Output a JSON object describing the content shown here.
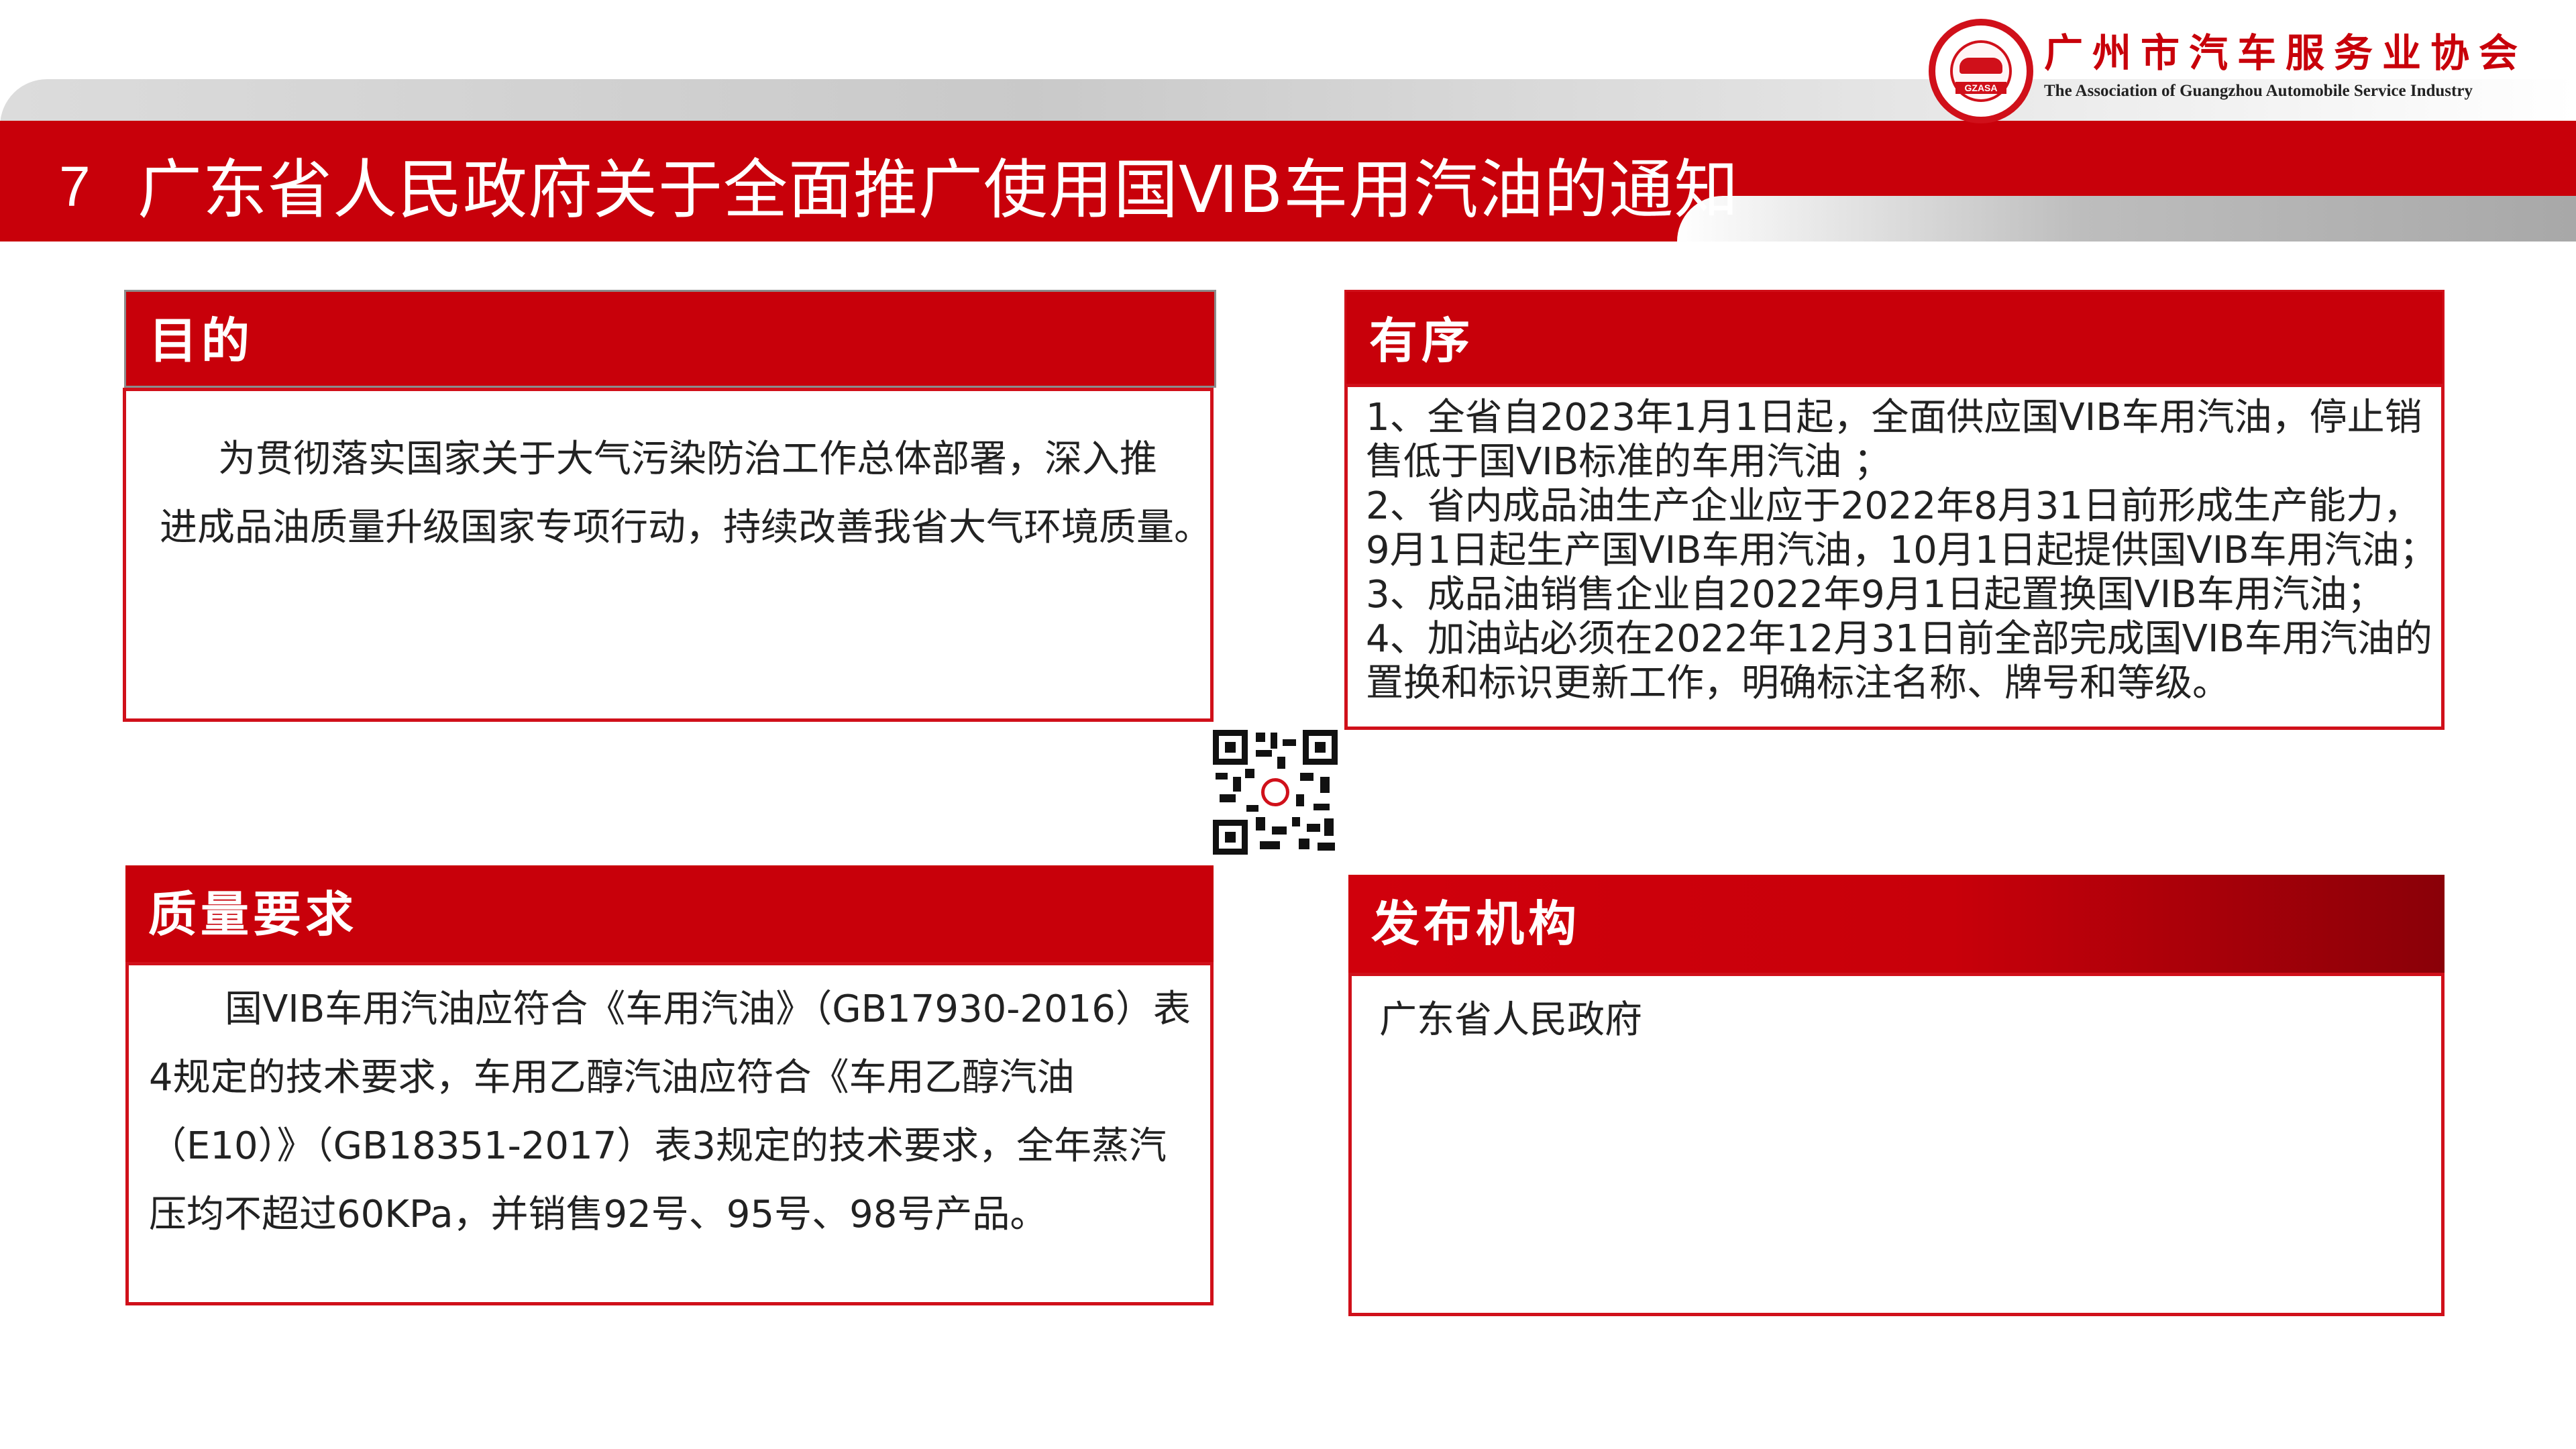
{
  "header": {
    "number": "7",
    "title": "广东省人民政府关于全面推广使用国ⅥB车用汽油的通知",
    "org_cn": "广州市汽车服务业协会",
    "org_en": "The Association of Guangzhou Automobile Service Industry",
    "seal_text": "GZASA"
  },
  "colors": {
    "brand_red": "#c8000a",
    "border_red": "#d0101a"
  },
  "icons": {
    "logo": "association-seal-icon",
    "qr": "qr-code-icon"
  },
  "panels": {
    "purpose": {
      "title": "目的",
      "lines": [
        "为贯彻落实国家关于大气污染防治工作总体部署，深入推",
        "进成品油质量升级国家专项行动，持续改善我省大气环境质量。"
      ]
    },
    "order": {
      "title": "有序",
      "lines": [
        "1、全省自2023年1月1日起，全面供应国VIB车用汽油，停止销",
        "售低于国VIB标准的车用汽油 ；",
        "2、省内成品油生产企业应于2022年8月31日前形成生产能力，",
        "9月1日起生产国VIB车用汽油，10月1日起提供国VIB车用汽油；",
        "3、成品油销售企业自2022年9月1日起置换国VIB车用汽油；",
        "4、加油站必须在2022年12月31日前全部完成国VIB车用汽油的",
        "置换和标识更新工作，明确标注名称、牌号和等级。"
      ]
    },
    "quality": {
      "title": "质量要求",
      "lines": [
        "国VIB车用汽油应符合《车用汽油》（GB17930-2016）表",
        "4规定的技术要求，车用乙醇汽油应符合《车用乙醇汽油",
        "（E10）》（GB18351-2017）表3规定的技术要求，全年蒸汽",
        "压均不超过60KPa，并销售92号、95号、98号产品。"
      ]
    },
    "publisher": {
      "title": "发布机构",
      "lines": [
        "广东省人民政府"
      ]
    }
  }
}
